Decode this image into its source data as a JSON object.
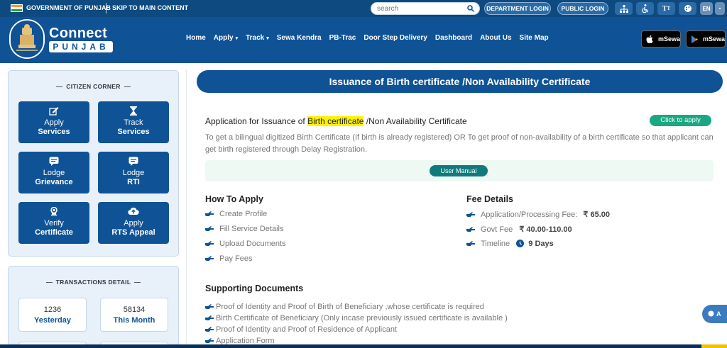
{
  "topbar": {
    "gov_label": "GOVERNMENT OF PUNJAB",
    "skip_label": "SKIP TO MAIN CONTENT",
    "search_placeholder": "search",
    "department_login": "DEPARTMENT LOGIN",
    "public_login": "PUBLIC LOGIN",
    "lang_label": "EN"
  },
  "header": {
    "brand_line1": "Connect",
    "brand_line2": "PUNJAB",
    "nav": [
      {
        "label": "Home"
      },
      {
        "label": "Apply",
        "caret": "▾"
      },
      {
        "label": "Track",
        "caret": "▾"
      },
      {
        "label": "Sewa Kendra"
      },
      {
        "label": "PB-Trac"
      },
      {
        "label": "Door Step Delivery"
      },
      {
        "label": "Dashboard"
      },
      {
        "label": "About Us"
      },
      {
        "label": "Site Map"
      }
    ],
    "apple_store": "mSewa",
    "play_store": "mSewa"
  },
  "sidebar": {
    "citizen_corner": "CITIZEN CORNER",
    "tiles": [
      {
        "line1": "Apply",
        "line2": "Services",
        "icon": "edit-icon"
      },
      {
        "line1": "Track",
        "line2": "Services",
        "icon": "hourglass-icon"
      },
      {
        "line1": "Lodge",
        "line2": "Grievance",
        "icon": "message-icon"
      },
      {
        "line1": "Lodge",
        "line2": "RTI",
        "icon": "message-icon"
      },
      {
        "line1": "Verify",
        "line2": "Certificate",
        "icon": "award-icon"
      },
      {
        "line1": "Apply",
        "line2": "RTS Appeal",
        "icon": "cloud-upload-icon"
      }
    ],
    "transactions_title": "TRANSACTIONS DETAIL",
    "transactions": [
      {
        "value": "1236",
        "period": "Yesterday"
      },
      {
        "value": "58134",
        "period": "This Month"
      }
    ]
  },
  "main": {
    "banner_title": "Issuance of Birth certificate /Non Availability Certificate",
    "app_title_prefix": "Application for Issuance of ",
    "app_title_highlight": "Birth certificate",
    "app_title_suffix": " /Non Availability Certificate",
    "click_to_apply": "Click to apply",
    "description": "To get a bilingual digitized Birth Certificate (If birth is already registered) OR To get proof of non-availability of a birth certificate so that applicant can get birth registered through Delay Registration.",
    "user_manual": "User Manual",
    "how_to_apply_title": "How To Apply",
    "how_to_apply": [
      "Create Profile",
      "Fill Service Details",
      "Upload Documents",
      "Pay Fees"
    ],
    "fee_title": "Fee Details",
    "fees": [
      {
        "label": "Application/Processing Fee:",
        "symbol": "₹",
        "value": "65.00"
      },
      {
        "label": "Govt Fee",
        "symbol": "₹",
        "value": "40.00-110.00"
      },
      {
        "label": "Timeline",
        "value": "9 Days"
      }
    ],
    "supporting_title": "Supporting Documents",
    "supporting": [
      "Proof of Identity and Proof of Birth of Beneficiary ,whose certificate is required",
      "Birth Certificate of Beneficiary (Only incase previously issued certificate is available )",
      "Proof of Identity and Proof of Residence of Applicant",
      "Application Form"
    ],
    "float_label": "A"
  }
}
